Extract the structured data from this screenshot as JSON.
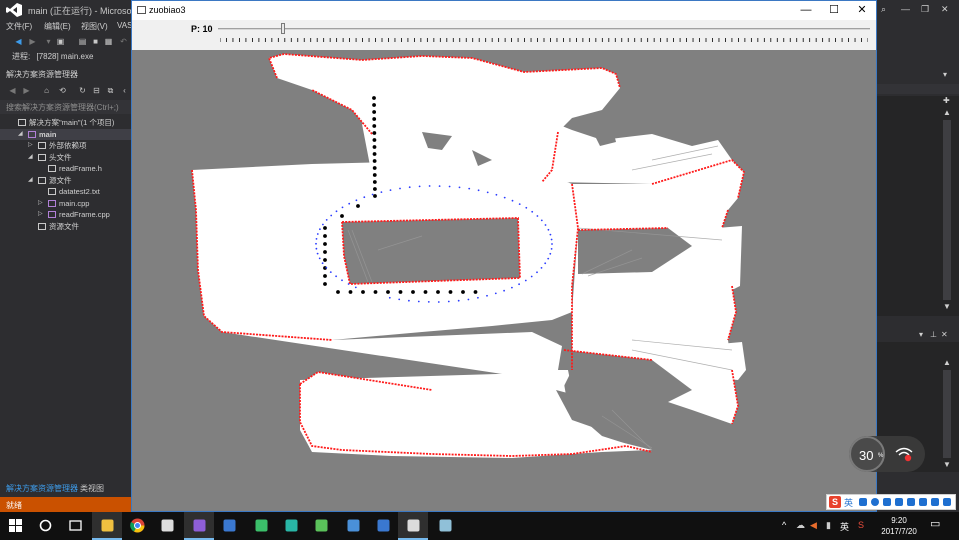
{
  "vs": {
    "title": "main (正在运行) - Microsoft V",
    "menu": [
      "文件(F)",
      "编辑(E)",
      "视图(V)",
      "VAS"
    ],
    "process_label": "进程:",
    "process_value": "[7828] main.exe",
    "solution_explorer_title": "解决方案资源管理器",
    "search_placeholder": "搜索解决方案资源管理器(Ctrl+;)",
    "tree": [
      {
        "label": "解决方案\"main\"(1 个项目)",
        "indent": 0,
        "arrow": "",
        "icon": "solution-icon"
      },
      {
        "label": "main",
        "indent": 1,
        "arrow": "◢",
        "icon": "project-icon",
        "selected": true,
        "bold": true
      },
      {
        "label": "外部依赖项",
        "indent": 2,
        "arrow": "▷",
        "icon": "dependencies-icon"
      },
      {
        "label": "头文件",
        "indent": 2,
        "arrow": "◢",
        "icon": "folder-icon"
      },
      {
        "label": "readFrame.h",
        "indent": 3,
        "arrow": "",
        "icon": "header-file-icon"
      },
      {
        "label": "源文件",
        "indent": 2,
        "arrow": "◢",
        "icon": "folder-icon"
      },
      {
        "label": "datatest2.txt",
        "indent": 3,
        "arrow": "",
        "icon": "text-file-icon"
      },
      {
        "label": "main.cpp",
        "indent": 3,
        "arrow": "▷",
        "icon": "cpp-file-icon"
      },
      {
        "label": "readFrame.cpp",
        "indent": 3,
        "arrow": "▷",
        "icon": "cpp-file-icon"
      },
      {
        "label": "资源文件",
        "indent": 2,
        "arrow": "",
        "icon": "folder-icon"
      }
    ],
    "bottom_tabs": [
      "解决方案资源管理器",
      "类视图"
    ],
    "status": "就绪"
  },
  "window": {
    "title": "zuobiao3",
    "controls": [
      "—",
      "☐",
      "✕"
    ],
    "slider_label": "P: 10",
    "slider_value_fraction": 0.1
  },
  "net_widget": {
    "value": "30",
    "unit": "%"
  },
  "ime": {
    "lang": "英"
  },
  "tray": {
    "time": "9:20",
    "date": "2017/7/20",
    "lang": "英"
  },
  "taskbar_items": [
    {
      "name": "start-icon"
    },
    {
      "name": "search-icon"
    },
    {
      "name": "task-view-icon"
    },
    {
      "name": "file-explorer-icon",
      "active": true
    },
    {
      "name": "chrome-icon"
    },
    {
      "name": "tools-icon"
    },
    {
      "name": "visual-studio-icon",
      "active": true
    },
    {
      "name": "iis-icon"
    },
    {
      "name": "vim-icon"
    },
    {
      "name": "app-green-icon"
    },
    {
      "name": "app-qq-icon"
    },
    {
      "name": "app-wing-icon"
    },
    {
      "name": "app-store-icon"
    },
    {
      "name": "zuobiao3-taskbar-icon",
      "active": true
    },
    {
      "name": "app-parrot-icon"
    }
  ],
  "colors": {
    "map_free": "#ffffff",
    "map_unknown": "#808080",
    "map_obstacle": "#ff1a1a",
    "path_black": "#000000",
    "path_blue": "#2a3cff"
  }
}
